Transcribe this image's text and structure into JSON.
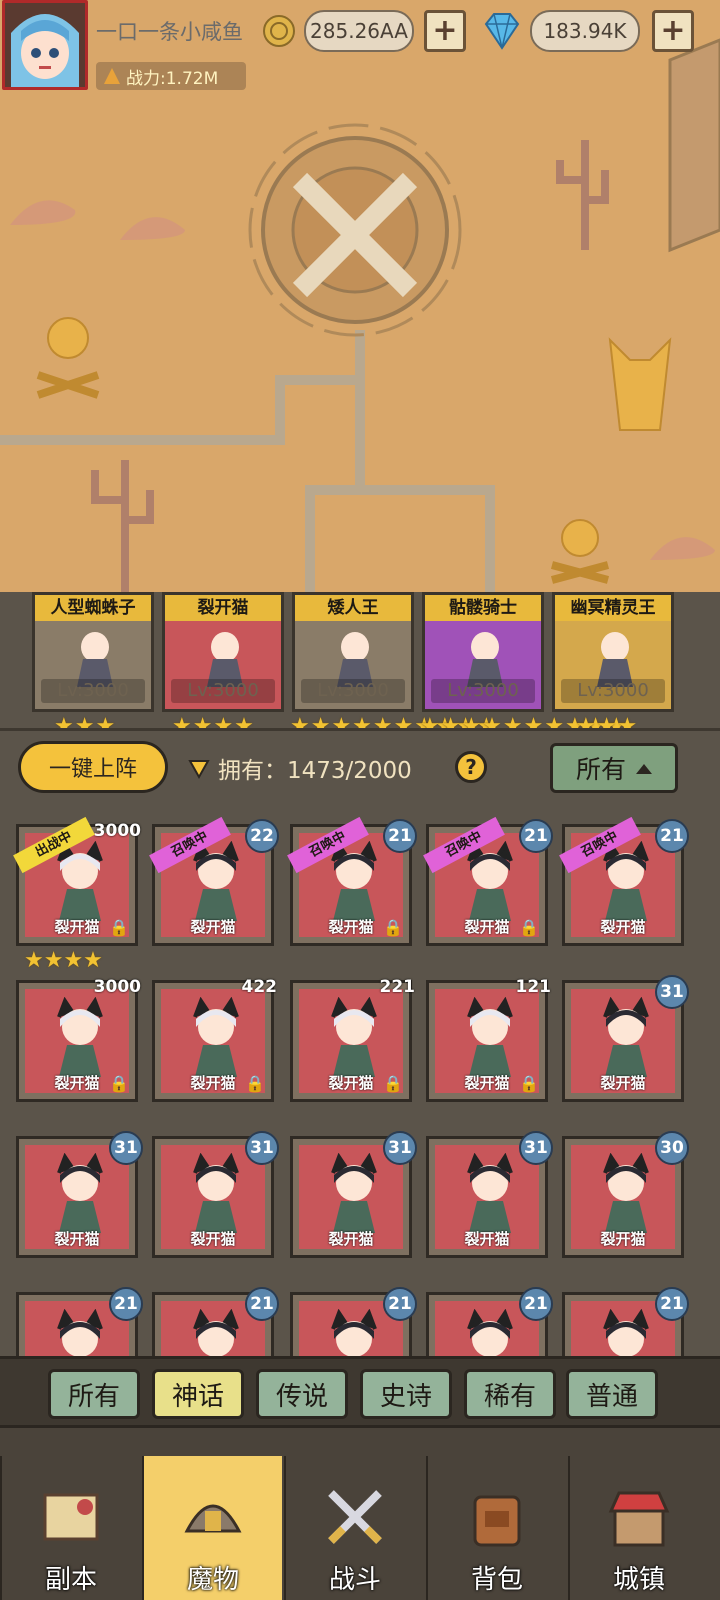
{
  "player": {
    "name": "一口一条小咸鱼",
    "power": "战力:1.72M"
  },
  "resources": {
    "gold": "285.26AA",
    "gems": "183.94K"
  },
  "lineup": [
    {
      "name": "人型蜘蛛子",
      "level": "Lv:3000",
      "stars": 3,
      "color": "#8a7c68"
    },
    {
      "name": "裂开猫",
      "level": "Lv:3000",
      "stars": 4,
      "color": "#c8565a"
    },
    {
      "name": "矮人王",
      "level": "Lv:3000",
      "stars": 10,
      "color": "#8a7c68"
    },
    {
      "name": "骷髅骑士",
      "level": "Lv:3000",
      "stars": 10,
      "color": "#a052b8"
    },
    {
      "name": "幽冥精灵王",
      "level": "Lv:3000",
      "stars": 3,
      "color": "#d4a84c"
    }
  ],
  "toolbar": {
    "deploy": "一键上阵",
    "own_label": "拥有：",
    "own_value": "1473/2000",
    "help": "?",
    "filter": "所有"
  },
  "monsters": [
    {
      "name": "裂开猫",
      "level": "3000",
      "ribbon": "出战中",
      "ribbon_color": "yellow",
      "locked": true,
      "stars": 4,
      "bubble": false
    },
    {
      "name": "裂开猫",
      "level": "22",
      "ribbon": "召唤中",
      "ribbon_color": "pink",
      "locked": false,
      "bubble": true
    },
    {
      "name": "裂开猫",
      "level": "21",
      "ribbon": "召唤中",
      "ribbon_color": "pink",
      "locked": true,
      "bubble": true
    },
    {
      "name": "裂开猫",
      "level": "21",
      "ribbon": "召唤中",
      "ribbon_color": "pink",
      "locked": true,
      "bubble": true
    },
    {
      "name": "裂开猫",
      "level": "21",
      "ribbon": "召唤中",
      "ribbon_color": "pink",
      "locked": false,
      "bubble": true
    },
    {
      "name": "裂开猫",
      "level": "3000",
      "locked": true,
      "bubble": false
    },
    {
      "name": "裂开猫",
      "level": "422",
      "locked": true,
      "bubble": false
    },
    {
      "name": "裂开猫",
      "level": "221",
      "locked": true,
      "bubble": false
    },
    {
      "name": "裂开猫",
      "level": "121",
      "locked": true,
      "bubble": false
    },
    {
      "name": "裂开猫",
      "level": "31",
      "locked": false,
      "bubble": true
    },
    {
      "name": "裂开猫",
      "level": "31",
      "locked": false,
      "bubble": true
    },
    {
      "name": "裂开猫",
      "level": "31",
      "locked": false,
      "bubble": true
    },
    {
      "name": "裂开猫",
      "level": "31",
      "locked": false,
      "bubble": true
    },
    {
      "name": "裂开猫",
      "level": "31",
      "locked": false,
      "bubble": true
    },
    {
      "name": "裂开猫",
      "level": "30",
      "locked": false,
      "bubble": true
    },
    {
      "name": "",
      "level": "21",
      "locked": false,
      "bubble": true
    },
    {
      "name": "",
      "level": "21",
      "locked": false,
      "bubble": true
    },
    {
      "name": "",
      "level": "21",
      "locked": false,
      "bubble": true
    },
    {
      "name": "",
      "level": "21",
      "locked": false,
      "bubble": true
    },
    {
      "name": "",
      "level": "21",
      "locked": false,
      "bubble": true
    }
  ],
  "rarity_tabs": [
    "所有",
    "神话",
    "传说",
    "史诗",
    "稀有",
    "普通"
  ],
  "rarity_active": 1,
  "nav": [
    {
      "label": "副本",
      "icon": "map-icon"
    },
    {
      "label": "魔物",
      "icon": "helmet-icon"
    },
    {
      "label": "战斗",
      "icon": "swords-icon"
    },
    {
      "label": "背包",
      "icon": "backpack-icon"
    },
    {
      "label": "城镇",
      "icon": "shop-icon"
    }
  ],
  "nav_active": 1
}
